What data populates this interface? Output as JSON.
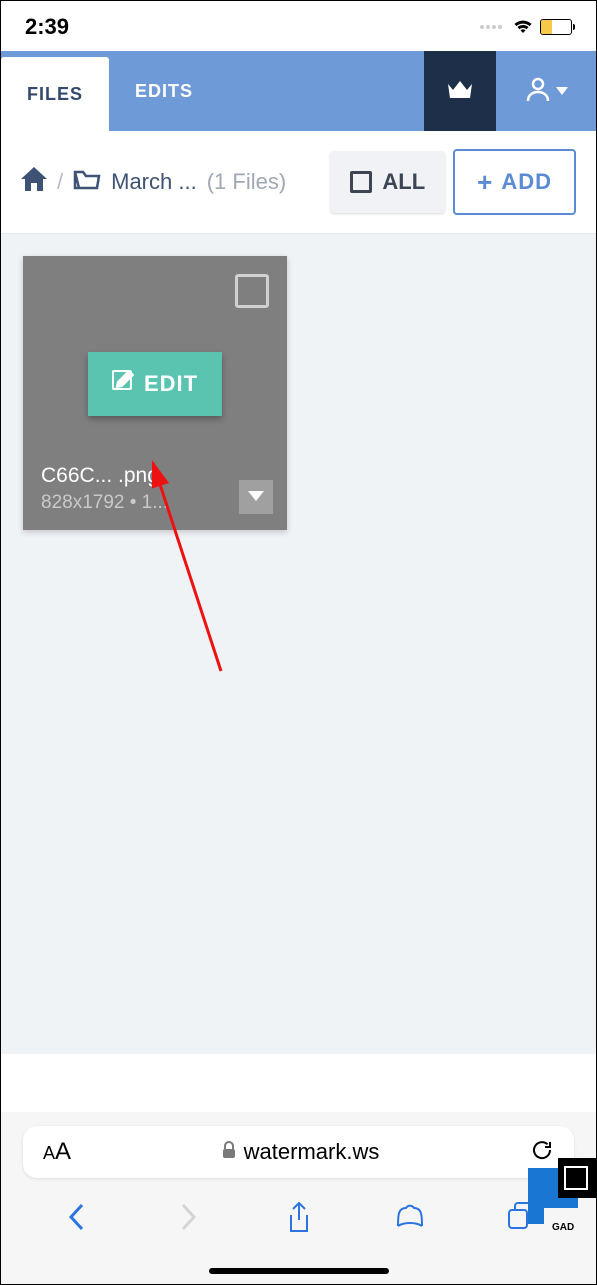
{
  "status": {
    "time": "2:39"
  },
  "header": {
    "tabs": {
      "files": "FILES",
      "edits": "EDITS"
    }
  },
  "breadcrumb": {
    "folder": "March ...",
    "count": "(1 Files)"
  },
  "toolbar": {
    "all_label": "ALL",
    "add_label": "ADD"
  },
  "file": {
    "edit_label": "EDIT",
    "name": "C66C...  .png",
    "meta": "828x1792 • 1..."
  },
  "browser": {
    "url": "watermark.ws"
  },
  "badge": {
    "text": "GAD"
  }
}
